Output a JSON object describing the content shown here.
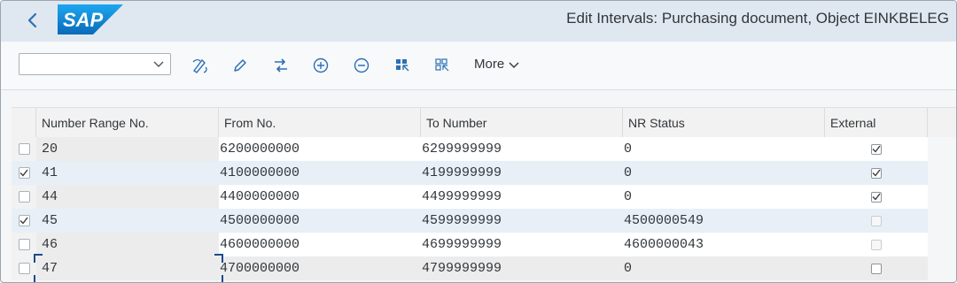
{
  "header": {
    "title": "Edit Intervals: Purchasing document, Object EINKBELEG",
    "logo_text": "SAP"
  },
  "toolbar": {
    "dropdown_value": "",
    "buttons": [
      "change-icon",
      "edit-icon",
      "transport-icon",
      "add-icon",
      "remove-icon",
      "select-all-icon",
      "deselect-all-icon"
    ],
    "more_label": "More"
  },
  "table": {
    "columns": [
      "Number Range No.",
      "From No.",
      "To Number",
      "NR Status",
      "External"
    ],
    "rows": [
      {
        "selected": false,
        "nr": "20",
        "from": "6200000000",
        "to": "6299999999",
        "status": "0",
        "external": true,
        "external_enabled": true
      },
      {
        "selected": true,
        "nr": "41",
        "from": "4100000000",
        "to": "4199999999",
        "status": "0",
        "external": true,
        "external_enabled": true
      },
      {
        "selected": false,
        "nr": "44",
        "from": "4400000000",
        "to": "4499999999",
        "status": "0",
        "external": true,
        "external_enabled": true
      },
      {
        "selected": true,
        "nr": "45",
        "from": "4500000000",
        "to": "4599999999",
        "status": "4500000549",
        "external": false,
        "external_enabled": false
      },
      {
        "selected": false,
        "nr": "46",
        "from": "4600000000",
        "to": "4699999999",
        "status": "4600000043",
        "external": false,
        "external_enabled": false
      },
      {
        "selected": false,
        "nr": "47",
        "from": "4700000000",
        "to": "4799999999",
        "status": "0",
        "external": false,
        "external_enabled": true
      }
    ]
  },
  "colors": {
    "shell_bg": "#dfe8f1",
    "logo_blue": "#1a8bd6",
    "selected_row": "#e8eff7",
    "focus_bracket": "#1c4a8c"
  }
}
